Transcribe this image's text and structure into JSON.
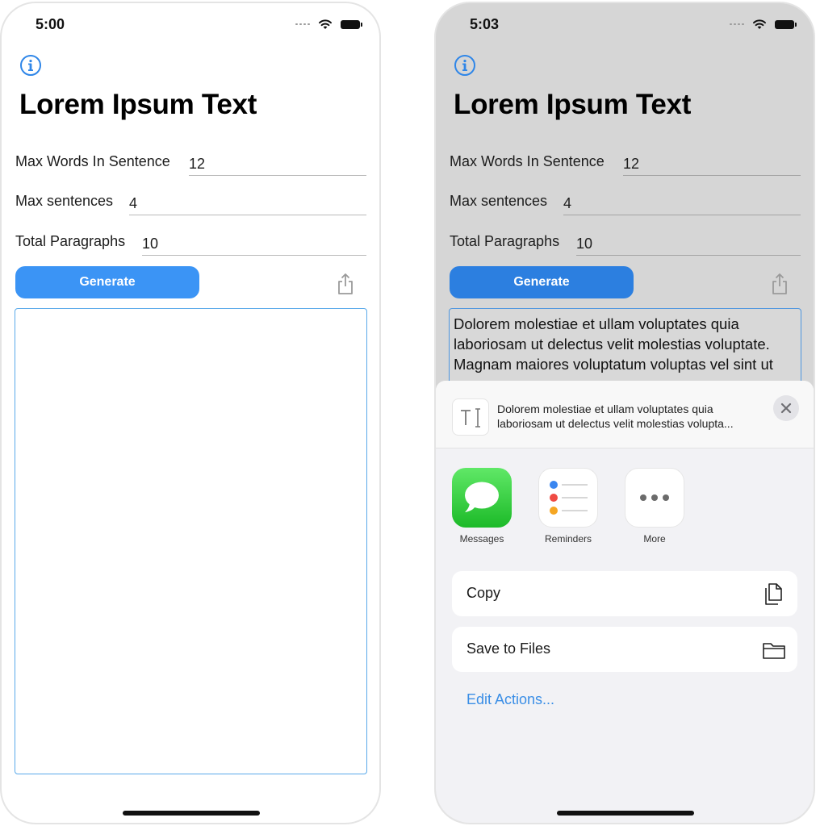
{
  "screen1": {
    "status_time": "5:00",
    "title": "Lorem Ipsum Text",
    "fields": [
      {
        "label": "Max Words In Sentence",
        "value": "12"
      },
      {
        "label": "Max sentences",
        "value": "4"
      },
      {
        "label": "Total Paragraphs",
        "value": "10"
      }
    ],
    "generate_label": "Generate",
    "output_text": ""
  },
  "screen2": {
    "status_time": "5:03",
    "title": "Lorem Ipsum Text",
    "fields": [
      {
        "label": "Max Words In Sentence",
        "value": "12"
      },
      {
        "label": "Max sentences",
        "value": "4"
      },
      {
        "label": "Total Paragraphs",
        "value": "10"
      }
    ],
    "generate_label": "Generate",
    "output_text": "Dolorem molestiae et ullam voluptates quia laboriosam ut delectus velit molestias voluptate. Magnam maiores voluptatum voluptas vel sint ut",
    "share_sheet": {
      "preview_line1": "Dolorem molestiae et ullam voluptates quia",
      "preview_line2": "laboriosam ut delectus velit molestias volupta...",
      "apps": [
        {
          "label": "Messages",
          "icon": "messages-icon"
        },
        {
          "label": "Reminders",
          "icon": "reminders-icon"
        },
        {
          "label": "More",
          "icon": "more-icon"
        }
      ],
      "actions": [
        {
          "label": "Copy",
          "icon": "copy-icon"
        },
        {
          "label": "Save to Files",
          "icon": "folder-icon"
        }
      ],
      "edit_actions_label": "Edit Actions..."
    }
  },
  "colors": {
    "accent": "#3b94f5",
    "link": "#3a8ee6",
    "text_border": "#59a9ea",
    "messages_green": "#1cba28",
    "reminder_blue": "#3a86f0",
    "reminder_red": "#ef4b43",
    "reminder_orange": "#f5a623"
  }
}
